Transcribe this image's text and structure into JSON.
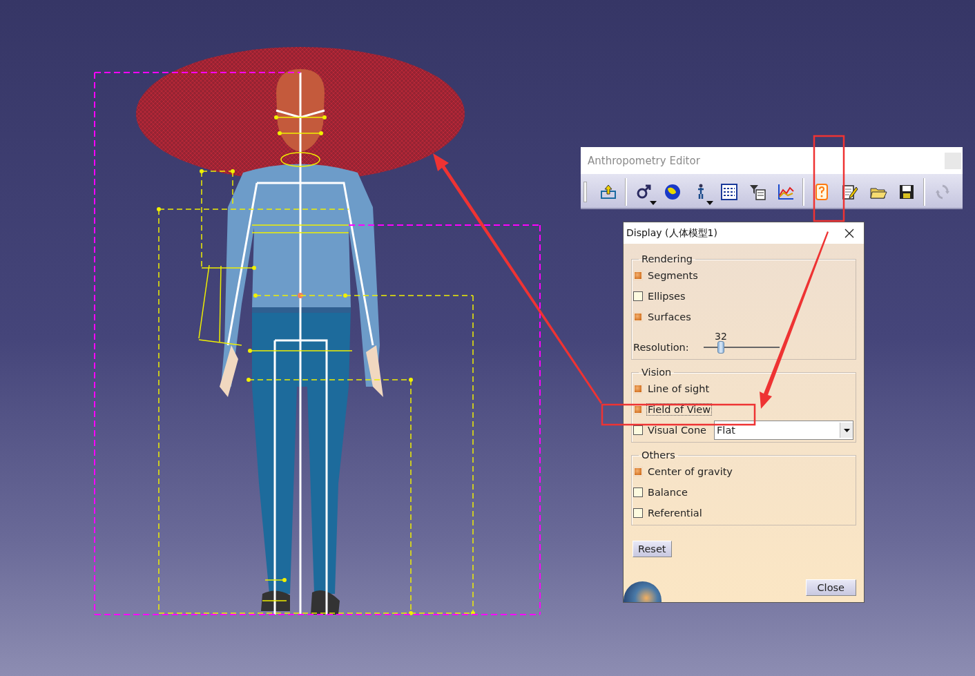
{
  "toolbar": {
    "title": "Anthropometry Editor",
    "groups": [
      [
        {
          "kind": "export",
          "has_menu": false,
          "disabled": false
        }
      ],
      [
        {
          "kind": "gender",
          "has_menu": true,
          "disabled": false
        },
        {
          "kind": "globe",
          "has_menu": false,
          "disabled": false
        },
        {
          "kind": "figure",
          "has_menu": true,
          "disabled": false
        },
        {
          "kind": "table",
          "has_menu": false,
          "disabled": false
        },
        {
          "kind": "filter",
          "has_menu": false,
          "disabled": false
        },
        {
          "kind": "chart",
          "has_menu": false,
          "disabled": false
        }
      ],
      [
        {
          "kind": "help",
          "has_menu": false,
          "disabled": false
        },
        {
          "kind": "edit",
          "has_menu": false,
          "disabled": false
        },
        {
          "kind": "open",
          "has_menu": false,
          "disabled": false
        },
        {
          "kind": "save",
          "has_menu": false,
          "disabled": false
        }
      ],
      [
        {
          "kind": "refresh",
          "has_menu": false,
          "disabled": true
        }
      ]
    ]
  },
  "dialog": {
    "title": "Display (人体模型1)",
    "groups": [
      {
        "legend": "Rendering",
        "items": [
          {
            "kind": "checkbox",
            "label": "Segments",
            "checked": true,
            "focused": false
          },
          {
            "kind": "checkbox",
            "label": "Ellipses",
            "checked": false,
            "focused": false
          },
          {
            "kind": "checkbox",
            "label": "Surfaces",
            "checked": true,
            "focused": false
          },
          {
            "kind": "slider",
            "label": "Resolution:",
            "reading": "32",
            "level": 0.23
          }
        ]
      },
      {
        "legend": "Vision",
        "items": [
          {
            "kind": "checkbox",
            "label": "Line of sight",
            "checked": true,
            "focused": false
          },
          {
            "kind": "checkbox",
            "label": "Field of View",
            "checked": true,
            "focused": true
          },
          {
            "kind": "checkbox_select",
            "label": "Visual Cone",
            "checked": false,
            "focused": false,
            "value": "Flat"
          }
        ]
      },
      {
        "legend": "Others",
        "items": [
          {
            "kind": "checkbox",
            "label": "Center of gravity",
            "checked": true,
            "focused": false
          },
          {
            "kind": "checkbox",
            "label": "Balance",
            "checked": false,
            "focused": false
          },
          {
            "kind": "checkbox",
            "label": "Referential",
            "checked": false,
            "focused": false
          }
        ]
      }
    ],
    "reset_button": "Reset",
    "close_button": "Close"
  }
}
